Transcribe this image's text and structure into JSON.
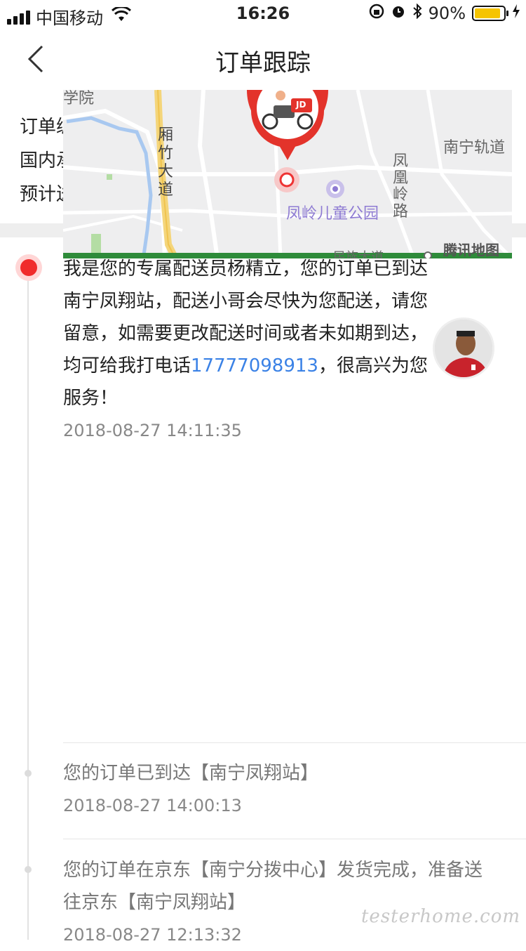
{
  "status_bar": {
    "carrier": "中国移动",
    "time": "16:26",
    "battery": "90%",
    "battery_level": 0.9
  },
  "navbar": {
    "title": "订单跟踪"
  },
  "order_info": {
    "line1": "订单编",
    "line2": "国内承",
    "line3": "预计送"
  },
  "map": {
    "labels": {
      "road1": "厢竹大道",
      "area_top": "学院",
      "metro": "南宁轨道",
      "road2": "凤凰岭路",
      "park": "凤岭儿童公园",
      "road3": "民族大道",
      "provider": "腾讯地图",
      "courier_badge": "JD"
    }
  },
  "timeline": {
    "latest": {
      "text_before_phone": "我是您的专属配送员杨精立，您的订单已到达南宁凤翔站，配送小哥会尽快为您配送，请您留意，如需要更改配送时间或者未如期到达，均可给我打电话",
      "phone": "17777098913",
      "text_after_phone": "，很高兴为您服务！",
      "time": "2018-08-27 14:11:35"
    },
    "entries": [
      {
        "text": "您的订单已到达【南宁凤翔站】",
        "time": "2018-08-27 14:00:13"
      },
      {
        "text": "您的订单在京东【南宁分拨中心】发货完成，准备送往京东【南宁凤翔站】",
        "time": "2018-08-27 12:13:32"
      }
    ]
  },
  "watermark": "testerhome.com"
}
